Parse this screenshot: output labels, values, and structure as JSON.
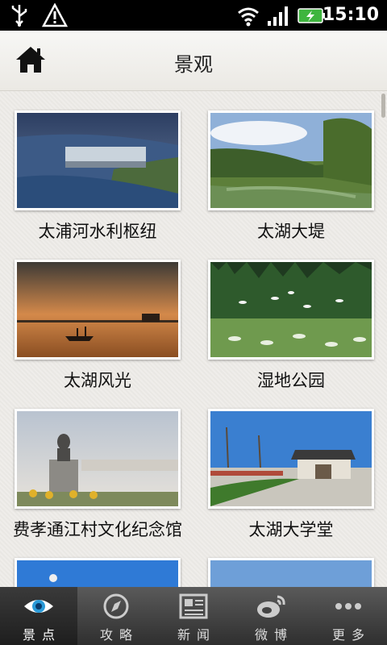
{
  "status_bar": {
    "time": "15:10"
  },
  "header": {
    "title": "景观"
  },
  "attractions": [
    {
      "name": "太浦河水利枢纽"
    },
    {
      "name": "太湖大堤"
    },
    {
      "name": "太湖风光"
    },
    {
      "name": "湿地公园"
    },
    {
      "name": "费孝通江村文化纪念馆"
    },
    {
      "name": "太湖大学堂"
    },
    {
      "name": ""
    },
    {
      "name": ""
    }
  ],
  "tabs": [
    {
      "label": "景点"
    },
    {
      "label": "攻略"
    },
    {
      "label": "新闻"
    },
    {
      "label": "微博"
    },
    {
      "label": "更多"
    }
  ]
}
